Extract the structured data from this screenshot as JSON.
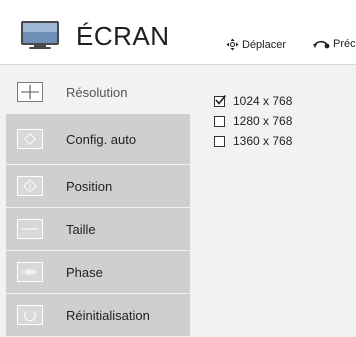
{
  "header": {
    "title": "ÉCRAN",
    "hints": {
      "move_label": "Déplacer",
      "prev_label": "Préc."
    }
  },
  "sidebar": {
    "items": [
      {
        "label": "Résolution",
        "icon": "crosshair-icon",
        "active": true
      },
      {
        "label": "Config. auto",
        "icon": "auto-config-icon",
        "active": false
      },
      {
        "label": "Position",
        "icon": "position-icon",
        "active": false
      },
      {
        "label": "Taille",
        "icon": "size-icon",
        "active": false
      },
      {
        "label": "Phase",
        "icon": "phase-icon",
        "active": false
      },
      {
        "label": "Réinitialisation",
        "icon": "reset-icon",
        "active": false
      }
    ]
  },
  "resolution": {
    "options": [
      {
        "label": "1024 x 768",
        "checked": true
      },
      {
        "label": "1280 x 768",
        "checked": false
      },
      {
        "label": "1360 x 768",
        "checked": false
      }
    ]
  },
  "colors": {
    "sidebar_item": "#cfcfcf",
    "panel_bg": "#f2f2f2",
    "text": "#222222"
  }
}
